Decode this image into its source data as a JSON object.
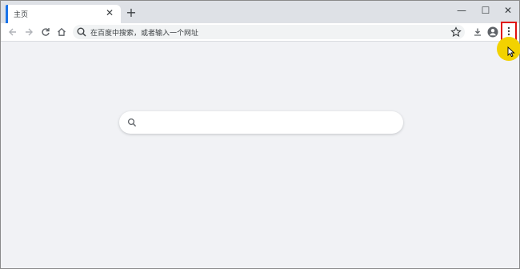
{
  "tab": {
    "title": "主页",
    "close": "✕",
    "new_tab": "+"
  },
  "window_controls": {
    "minimize": "—",
    "maximize": "☐",
    "close": "✕"
  },
  "toolbar": {
    "back_icon": "arrow-left-icon",
    "forward_icon": "arrow-right-icon",
    "reload_icon": "reload-icon",
    "home_icon": "home-icon",
    "omnibox_placeholder": "在百度中搜索，或者输入一个网址",
    "bookmark_icon": "star-icon",
    "download_icon": "download-icon",
    "profile_icon": "avatar-icon",
    "menu_icon": "kebab-menu-icon"
  },
  "new_tab_page": {
    "search_placeholder": ""
  },
  "colors": {
    "accent": "#1a73e8",
    "highlight_border": "#e01010",
    "cursor_halo": "#f2d200",
    "page_bg": "#f1f2f5"
  }
}
